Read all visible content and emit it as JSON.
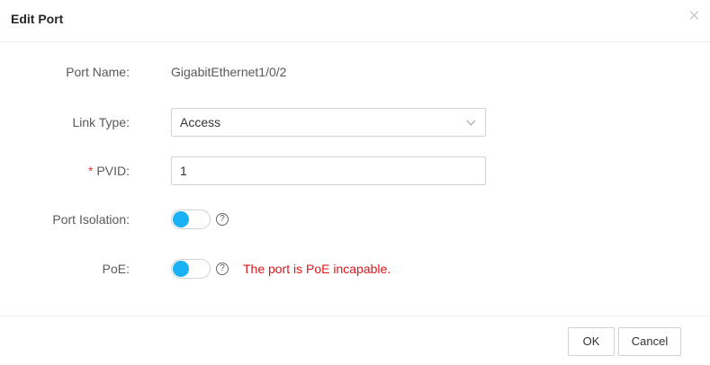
{
  "dialog": {
    "title": "Edit Port",
    "close_icon": "close-icon"
  },
  "form": {
    "port_name": {
      "label": "Port Name:",
      "value": "GigabitEthernet1/0/2"
    },
    "link_type": {
      "label": "Link Type:",
      "value": "Access"
    },
    "pvid": {
      "required_mark": "*",
      "label": "PVID:",
      "value": "1"
    },
    "port_isolation": {
      "label": "Port Isolation:",
      "help": "?",
      "enabled": true
    },
    "poe": {
      "label": "PoE:",
      "help": "?",
      "enabled": true,
      "message": "The port is PoE incapable."
    }
  },
  "footer": {
    "ok_label": "OK",
    "cancel_label": "Cancel"
  },
  "colors": {
    "toggle_on": "#1ab1f5",
    "error_text": "#e0151a",
    "required_mark": "#e53935"
  }
}
